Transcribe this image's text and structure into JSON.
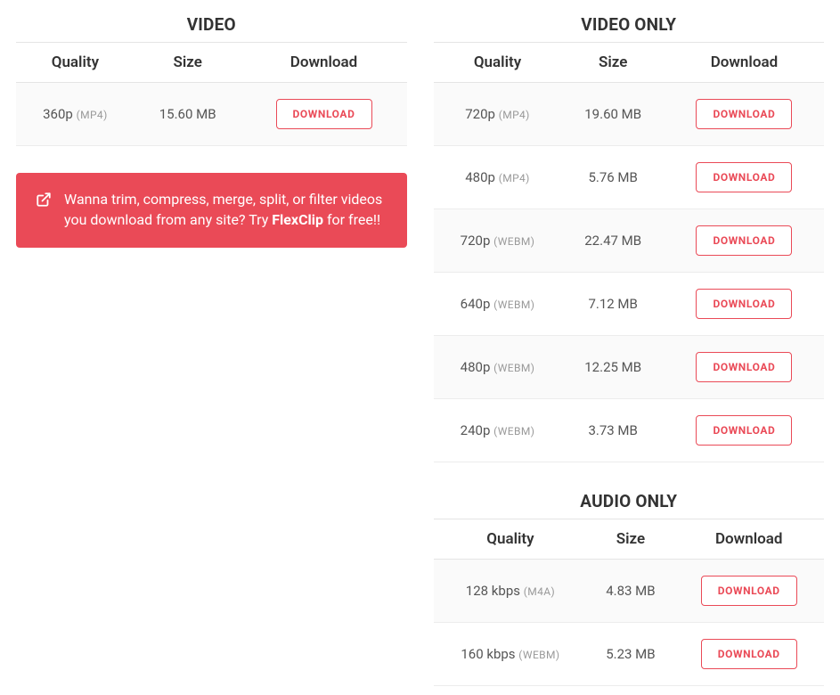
{
  "columns": {
    "quality": "Quality",
    "size": "Size",
    "download": "Download"
  },
  "buttons": {
    "download": "DOWNLOAD"
  },
  "sections": {
    "video": {
      "title": "VIDEO",
      "rows": [
        {
          "quality": "360p",
          "format": "(MP4)",
          "size": "15.60 MB"
        }
      ]
    },
    "video_only": {
      "title": "VIDEO ONLY",
      "rows": [
        {
          "quality": "720p",
          "format": "(MP4)",
          "size": "19.60 MB"
        },
        {
          "quality": "480p",
          "format": "(MP4)",
          "size": "5.76 MB"
        },
        {
          "quality": "720p",
          "format": "(WEBM)",
          "size": "22.47 MB"
        },
        {
          "quality": "640p",
          "format": "(WEBM)",
          "size": "7.12 MB"
        },
        {
          "quality": "480p",
          "format": "(WEBM)",
          "size": "12.25 MB"
        },
        {
          "quality": "240p",
          "format": "(WEBM)",
          "size": "3.73 MB"
        }
      ]
    },
    "audio_only": {
      "title": "AUDIO ONLY",
      "rows": [
        {
          "quality": "128 kbps",
          "format": "(M4A)",
          "size": "4.83 MB"
        },
        {
          "quality": "160 kbps",
          "format": "(WEBM)",
          "size": "5.23 MB"
        }
      ]
    }
  },
  "promo": {
    "text_before": "Wanna trim, compress, merge, split, or filter videos you download from any site? Try ",
    "bold": "FlexClip",
    "text_after": " for free!!"
  }
}
